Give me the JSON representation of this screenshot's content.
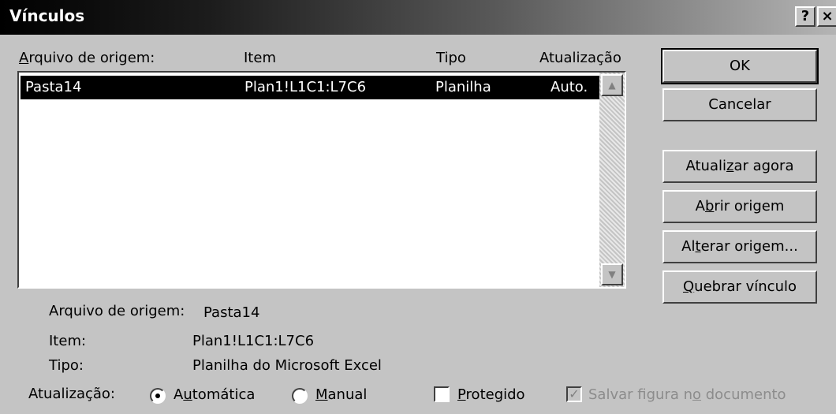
{
  "window": {
    "title": "Vínculos",
    "help_label": "?",
    "close_label": "×"
  },
  "list": {
    "headers": {
      "arquivo": "Arquivo de origem:",
      "item": "Item",
      "tipo": "Tipo",
      "atualizacao": "Atualização"
    },
    "rows": [
      {
        "arquivo": "Pasta14",
        "item": "Plan1!L1C1:L7C6",
        "tipo": "Planilha",
        "atualizacao": "Auto."
      }
    ],
    "scroll_up_label": "▲",
    "scroll_down_label": "▼"
  },
  "buttons": {
    "ok": "OK",
    "cancel": "Cancelar",
    "update_now": "Atualizar agora",
    "open_source": "Abrir origem",
    "change_source": "Alterar origem...",
    "break_link": "Quebrar vínculo"
  },
  "details": {
    "arquivo_label": "Arquivo de origem:",
    "arquivo_value": "Pasta14",
    "item_label": "Item:",
    "item_value": "Plan1!L1C1:L7C6",
    "tipo_label": "Tipo:",
    "tipo_value": "Planilha do Microsoft Excel"
  },
  "options": {
    "update_label": "Atualização:",
    "automatic_label": "Automática",
    "manual_label": "Manual",
    "selected_mode": "Automática",
    "protected_label": "Protegido",
    "protected_checked": false,
    "save_picture_label": "Salvar figura no documento",
    "save_picture_checked": true,
    "checkmark": "✓"
  }
}
